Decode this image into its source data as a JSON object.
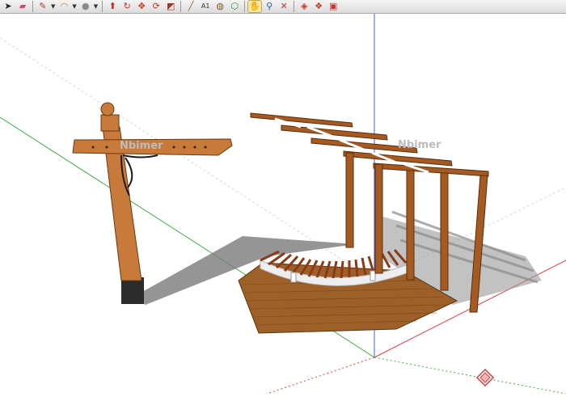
{
  "toolbar": {
    "tools": [
      {
        "name": "select-tool-icon",
        "glyph": "➤",
        "color": "#222222"
      },
      {
        "name": "eraser-tool-icon",
        "glyph": "▰",
        "color": "#d24a7a"
      },
      {
        "name": "pencil-line-tool-icon",
        "glyph": "✎",
        "color": "#b33a1e",
        "dropdown": true
      },
      {
        "name": "arc-tool-icon",
        "glyph": "◠",
        "color": "#b87840",
        "dropdown": true
      },
      {
        "name": "shape-tool-icon",
        "glyph": "●",
        "color": "#8a8a8a",
        "dropdown": true
      },
      {
        "name": "push-pull-tool-icon",
        "glyph": "⬆",
        "color": "#b7322a"
      },
      {
        "name": "follow-me-tool-icon",
        "glyph": "↻",
        "color": "#c0392b"
      },
      {
        "name": "move-tool-icon",
        "glyph": "✥",
        "color": "#c0392b"
      },
      {
        "name": "rotate-tool-icon",
        "glyph": "⟳",
        "color": "#c0392b"
      },
      {
        "name": "scale-tool-icon",
        "glyph": "◩",
        "color": "#a83226"
      },
      {
        "name": "tape-measure-tool-icon",
        "glyph": "╱",
        "color": "#8a6a1c"
      },
      {
        "name": "text-tool-icon",
        "glyph": "A1",
        "color": "#333333"
      },
      {
        "name": "paint-bucket-tool-icon",
        "glyph": "◍",
        "color": "#7a5a20"
      },
      {
        "name": "orbit-tool-icon",
        "glyph": "⬡",
        "color": "#2f8a3a"
      },
      {
        "name": "pan-tool-icon",
        "glyph": "✋",
        "color": "#7a5a20",
        "active": true
      },
      {
        "name": "zoom-tool-icon",
        "glyph": "⚲",
        "color": "#2c5aa0"
      },
      {
        "name": "zoom-extents-tool-icon",
        "glyph": "✕",
        "color": "#c0392b"
      },
      {
        "name": "warehouse-icon",
        "glyph": "◈",
        "color": "#c0392b"
      },
      {
        "name": "components-icon",
        "glyph": "❖",
        "color": "#c0392b"
      },
      {
        "name": "extension-icon",
        "glyph": "▣",
        "color": "#c0392b"
      }
    ]
  },
  "scene": {
    "watermark_left": "Nbimer",
    "watermark_right": "Nbimer",
    "wood_color": "#c77a3a",
    "wood_dark": "#8a4a1e",
    "deck_color": "#9c6028",
    "shadow_color": "#6a6a6a",
    "axis_red": "#e04040",
    "axis_green": "#3cb043",
    "axis_blue": "#4a5ad6"
  }
}
